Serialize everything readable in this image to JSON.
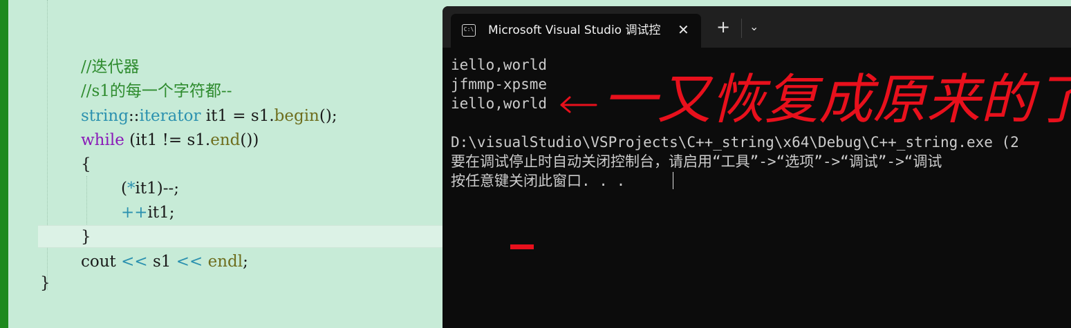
{
  "editor": {
    "lines": {
      "comment_iter": "//迭代器",
      "comment_s1": "//s1的每一个字符都--",
      "l3": {
        "type": "string",
        "sep": "::",
        "type2": "iterator",
        "rest1": " it1 = s1.",
        "fn": "begin",
        "rest2": "();"
      },
      "l4": {
        "kw": "while",
        "rest1": " (it1 != s1.",
        "fn": "end",
        "rest2": "())"
      },
      "open_brace": "{",
      "l6": {
        "p1": "(",
        "op": "*",
        "p2": "it1)--;"
      },
      "l7": {
        "op": "++",
        "p2": "it1;"
      },
      "close_brace": "}",
      "l9": {
        "p1": "cout ",
        "op1": "<<",
        "p2": " s1 ",
        "op2": "<<",
        "fn": " endl",
        "p3": ";"
      },
      "close_fn": "}"
    }
  },
  "console": {
    "tab_title": "Microsoft Visual Studio 调试控",
    "tab_icon_text": "C:\\",
    "close_glyph": "✕",
    "new_tab_glyph": "+",
    "dropdown_glyph": "⌄",
    "output": [
      "iello,world",
      "jfmmp-xpsme",
      "iello,world",
      "D:\\visualStudio\\VSProjects\\C++_string\\x64\\Debug\\C++_string.exe (2",
      "要在调试停止时自动关闭控制台，请启用“工具”->“选项”->“调试”->“调试",
      "按任意键关闭此窗口. . ."
    ],
    "annotation": "一又恢复成原来的了",
    "annotation_color": "#e8101c"
  }
}
